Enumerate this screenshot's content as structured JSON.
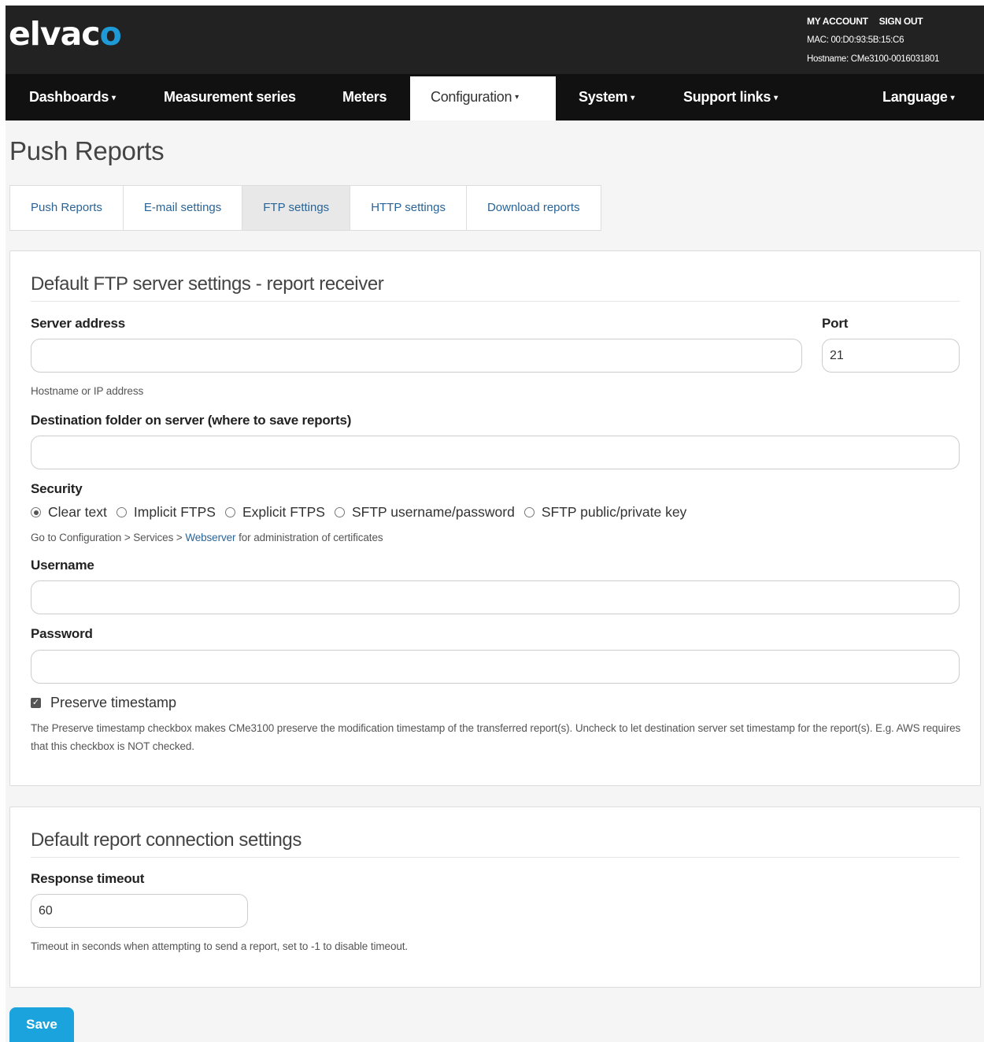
{
  "header": {
    "logo_main": "elvac",
    "logo_accent": "o",
    "my_account": "MY ACCOUNT",
    "sign_out": "SIGN OUT",
    "mac": "MAC: 00:D0:93:5B:15:C6",
    "hostname": "Hostname: CMe3100-0016031801"
  },
  "nav": {
    "dashboards": "Dashboards",
    "measurement_series": "Measurement series",
    "meters": "Meters",
    "configuration": "Configuration",
    "system": "System",
    "support_links": "Support links",
    "language": "Language",
    "caret": "▾"
  },
  "page": {
    "title": "Push Reports"
  },
  "tabs": {
    "push_reports": "Push Reports",
    "email_settings": "E-mail settings",
    "ftp_settings": "FTP settings",
    "http_settings": "HTTP settings",
    "download_reports": "Download reports"
  },
  "ftp_panel": {
    "title": "Default FTP server settings - report receiver",
    "server_address_label": "Server address",
    "server_address_value": "",
    "port_label": "Port",
    "port_value": "21",
    "server_help": "Hostname or IP address",
    "dest_folder_label": "Destination folder on server (where to save reports)",
    "dest_folder_value": "",
    "security_label": "Security",
    "security_options": {
      "clear_text": "Clear text",
      "implicit_ftps": "Implicit FTPS",
      "explicit_ftps": "Explicit FTPS",
      "sftp_userpass": "SFTP username/password",
      "sftp_key": "SFTP public/private key"
    },
    "security_selected": "Clear text",
    "security_help_prefix": "Go to Configuration > Services > ",
    "security_help_link": "Webserver",
    "security_help_suffix": " for administration of certificates",
    "username_label": "Username",
    "username_value": "",
    "password_label": "Password",
    "password_value": "",
    "preserve_label": "Preserve timestamp",
    "preserve_checked": true,
    "preserve_help": "The Preserve timestamp checkbox makes CMe3100 preserve the modification timestamp of the transferred report(s). Uncheck to let destination server set timestamp for the report(s). E.g. AWS requires that this checkbox is NOT checked."
  },
  "connection_panel": {
    "title": "Default report connection settings",
    "timeout_label": "Response timeout",
    "timeout_value": "60",
    "timeout_help": "Timeout in seconds when attempting to send a report, set to -1 to disable timeout."
  },
  "actions": {
    "save": "Save"
  },
  "colors": {
    "accent": "#1aa3dc",
    "logo_accent": "#1e9ad6",
    "topbar": "#222222",
    "navbar": "#111111",
    "link": "#2a6496"
  }
}
